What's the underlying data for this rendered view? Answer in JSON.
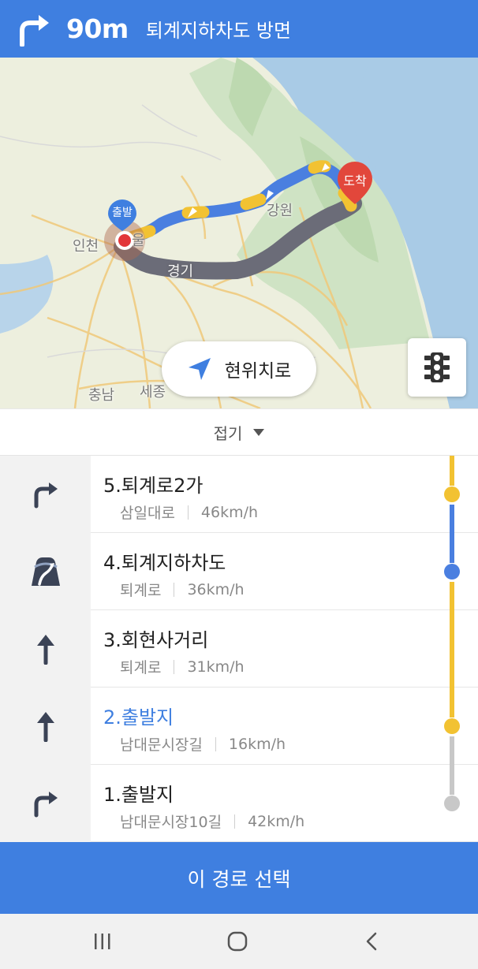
{
  "guidance": {
    "turn_icon": "turn-right-icon",
    "distance": "90m",
    "direction": "퇴계지하차도 방면"
  },
  "map": {
    "labels": {
      "incheon": "인천",
      "seoul_partial": "울",
      "gyeonggi": "경기",
      "gangwon": "강원",
      "chungnam": "충남",
      "sejong": "세종"
    },
    "start_pin": "출발",
    "end_pin": "도착",
    "locate_button": "현위치로",
    "traffic_icon": "traffic-light-icon",
    "colors": {
      "route_blue": "#4a7fe0",
      "route_yellow": "#f2c232",
      "route_gray": "#6b6c78",
      "start_pin": "#3f7fe0",
      "end_pin": "#e2473b"
    }
  },
  "collapse": {
    "label": "접기"
  },
  "steps": [
    {
      "title": "5.퇴계로2가",
      "road": "삼일대로",
      "speed": "46km/h",
      "icon": "turn-right-icon"
    },
    {
      "title": "4.퇴계지하차도",
      "road": "퇴계로",
      "speed": "36km/h",
      "icon": "underpass-icon"
    },
    {
      "title": "3.회현사거리",
      "road": "퇴계로",
      "speed": "31km/h",
      "icon": "straight-arrow-icon"
    },
    {
      "title": "2.출발지",
      "road": "남대문시장길",
      "speed": "16km/h",
      "icon": "straight-arrow-icon",
      "active": true
    },
    {
      "title": "1.출발지",
      "road": "남대문시장10길",
      "speed": "42km/h",
      "icon": "turn-right-icon"
    }
  ],
  "select_button": "이 경로 선택",
  "navbar": {
    "recent": "recent-apps-icon",
    "home": "home-icon",
    "back": "back-icon"
  }
}
